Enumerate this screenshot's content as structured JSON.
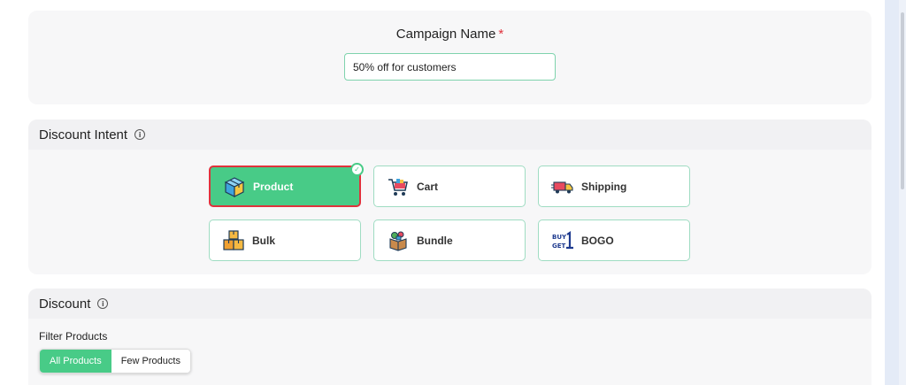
{
  "campaign": {
    "label": "Campaign Name",
    "required_mark": "*",
    "value": "50% off for customers"
  },
  "discount_intent": {
    "title": "Discount Intent",
    "info_glyph": "i",
    "selected": "Product",
    "options": [
      {
        "label": "Product",
        "icon": "box-icon"
      },
      {
        "label": "Cart",
        "icon": "cart-icon"
      },
      {
        "label": "Shipping",
        "icon": "truck-icon"
      },
      {
        "label": "Bulk",
        "icon": "stacked-boxes-icon"
      },
      {
        "label": "Bundle",
        "icon": "bundle-box-icon"
      },
      {
        "label": "BOGO",
        "icon": "buy-get-icon"
      }
    ]
  },
  "discount": {
    "title": "Discount",
    "info_glyph": "i",
    "filter_label": "Filter Products",
    "filter_options": [
      "All Products",
      "Few Products"
    ],
    "filter_selected": "All Products"
  },
  "colors": {
    "accent_green": "#48cb87",
    "selection_outline": "#e0323c",
    "required_red": "#e0323c"
  }
}
